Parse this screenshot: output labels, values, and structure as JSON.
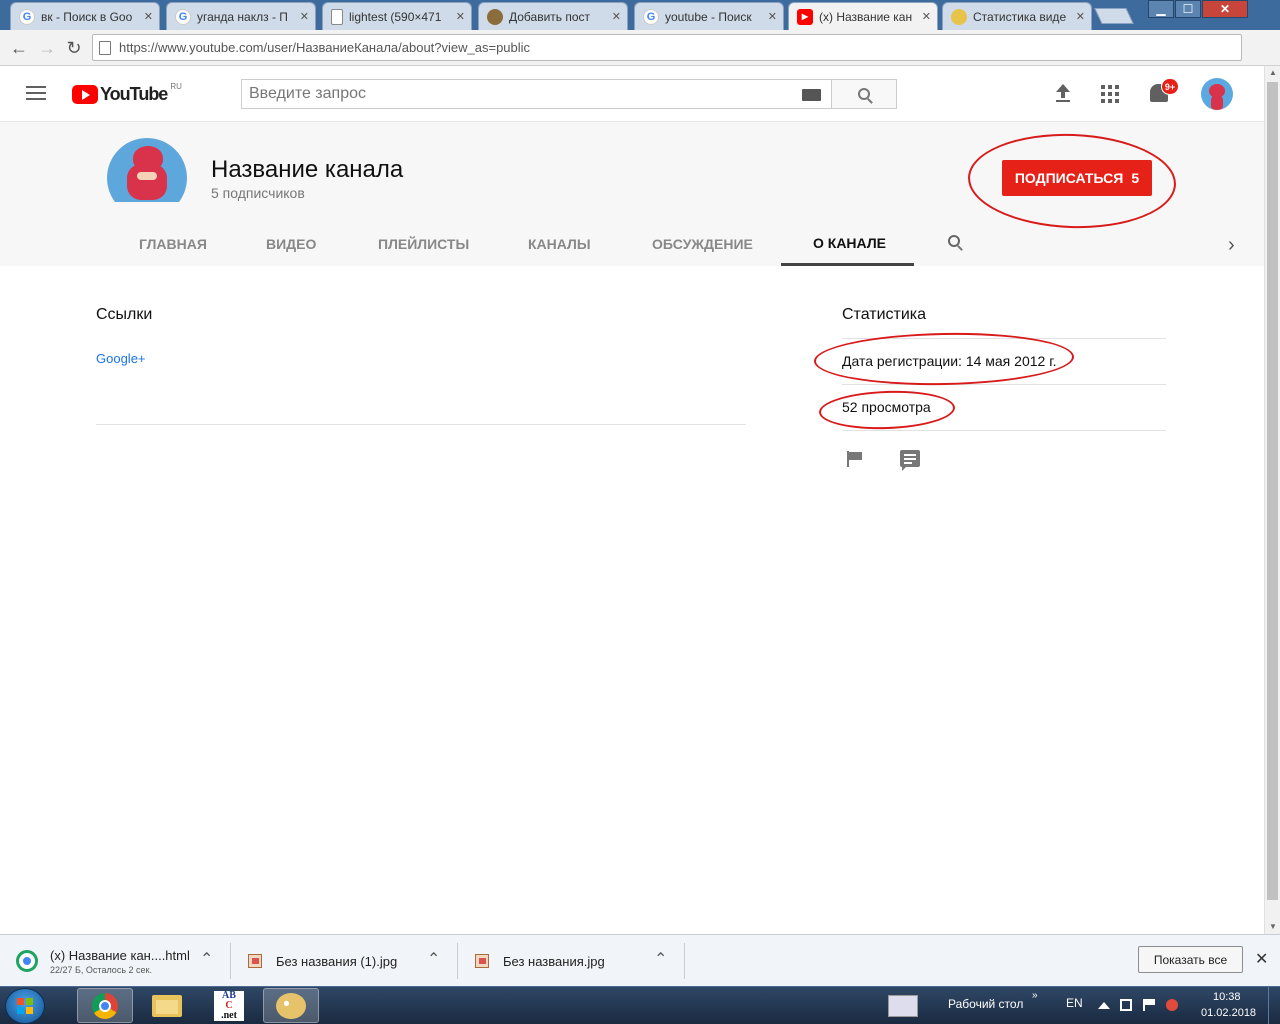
{
  "browser": {
    "tabs": [
      {
        "title": "вк - Поиск в Goo",
        "icon": "google-icon"
      },
      {
        "title": "уганда наклз - П",
        "icon": "google-icon"
      },
      {
        "title": "lightest (590×471",
        "icon": "document-icon"
      },
      {
        "title": "Добавить пост",
        "icon": "site-icon"
      },
      {
        "title": "youtube - Поиск",
        "icon": "google-icon"
      },
      {
        "title": "(x) Название кан",
        "icon": "youtube-icon"
      },
      {
        "title": "Статистика виде",
        "icon": "troll-icon"
      }
    ],
    "active_tab_index": 5,
    "url": "https://www.youtube.com/user/НазваниеКанала/about?view_as=public"
  },
  "youtube": {
    "logo_text": "YouTube",
    "region": "RU",
    "search_placeholder": "Введите запрос",
    "notification_badge": "9+",
    "brand_color": "#e62117"
  },
  "channel": {
    "title": "Название канала",
    "subscribers": "5 подписчиков",
    "subscribe_label": "ПОДПИСАТЬСЯ",
    "subscribe_count": "5",
    "tabs": [
      "ГЛАВНАЯ",
      "ВИДЕО",
      "ПЛЕЙЛИСТЫ",
      "КАНАЛЫ",
      "ОБСУЖДЕНИЕ",
      "О КАНАЛЕ"
    ],
    "selected_tab": "О КАНАЛЕ"
  },
  "about": {
    "links_heading": "Ссылки",
    "links": [
      "Google+"
    ],
    "stats_heading": "Статистика",
    "registration": "Дата регистрации: 14 мая 2012 г.",
    "views": "52 просмотра"
  },
  "downloads": {
    "items": [
      {
        "name": "(x) Название кан....html",
        "status": "22/27 Б, Осталось 2 сек."
      },
      {
        "name": "Без названия (1).jpg"
      },
      {
        "name": "Без названия.jpg"
      }
    ],
    "show_all": "Показать все"
  },
  "taskbar": {
    "desktop_label": "Рабочий стол",
    "language": "EN",
    "time": "10:38",
    "date": "01.02.2018",
    "abc_icon_lines": [
      "AB",
      "C",
      ".net"
    ]
  },
  "annotation_color": "#d81a1a"
}
